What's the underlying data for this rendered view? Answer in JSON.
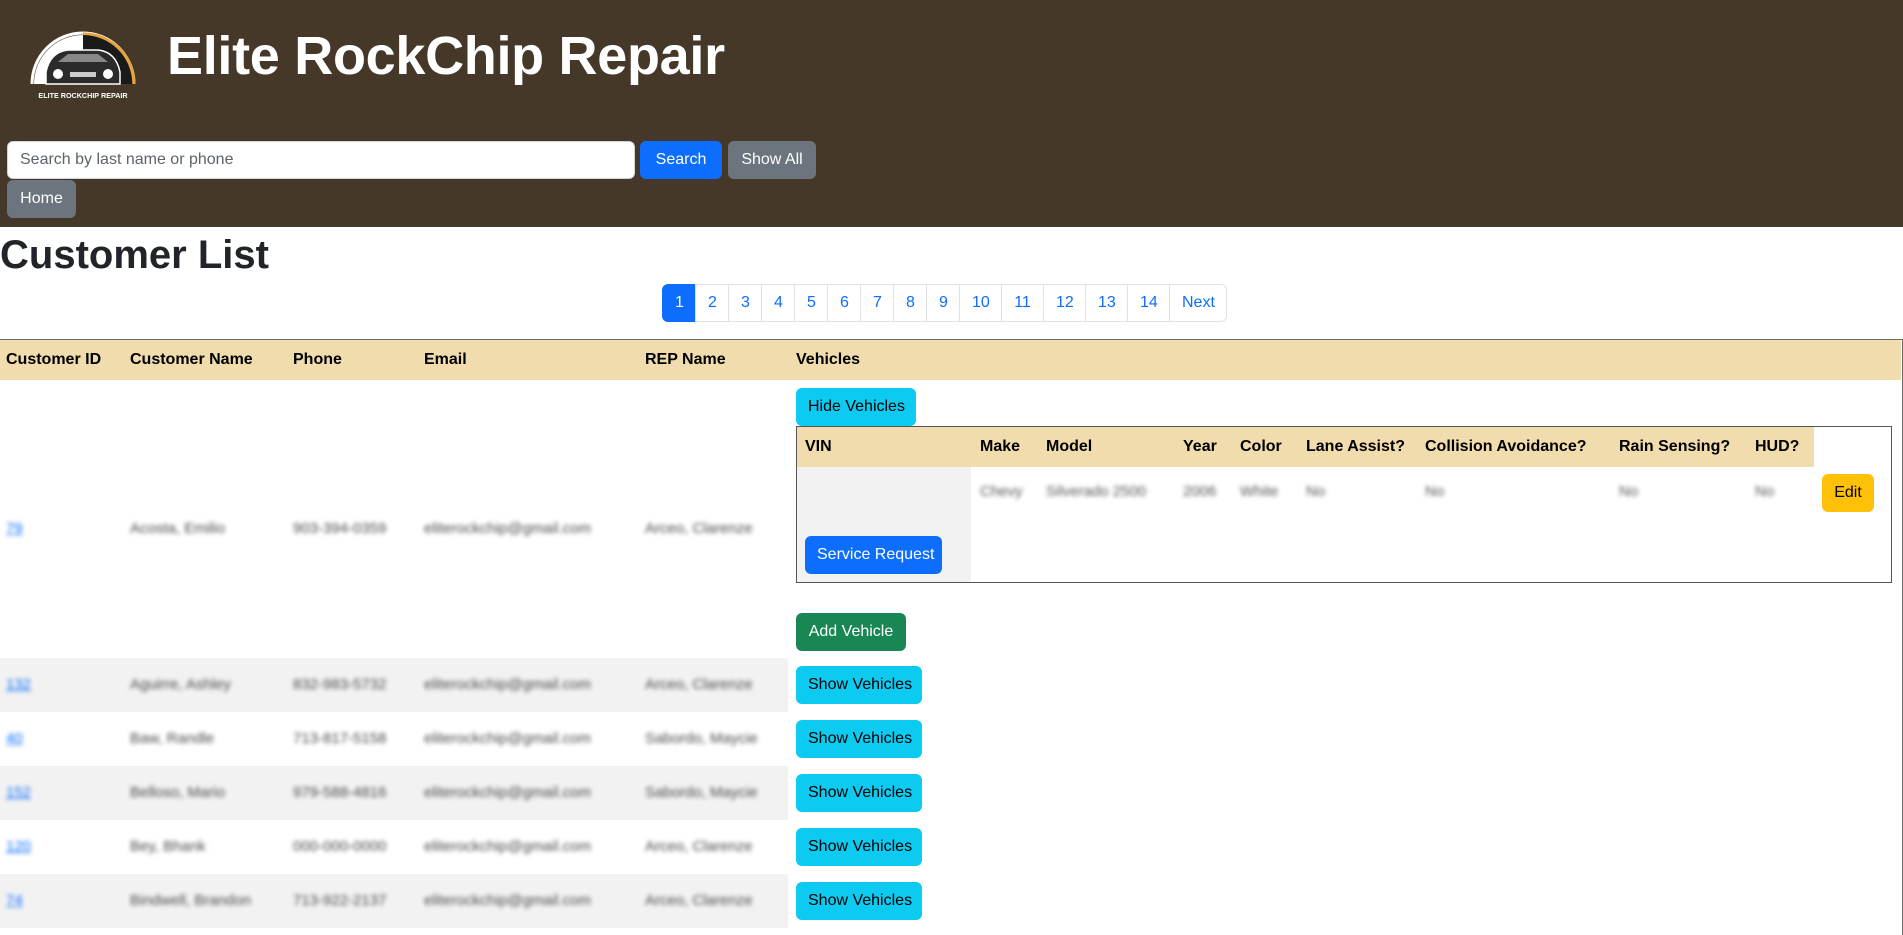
{
  "header": {
    "logo_text": "ELITE ROCKCHIP REPAIR",
    "title": "Elite RockChip Repair",
    "search_placeholder": "Search by last name or phone",
    "search_value": "",
    "search_label": "Search",
    "show_all_label": "Show All",
    "home_label": "Home",
    "background": "#453829"
  },
  "page": {
    "title": "Customer List"
  },
  "pagination": {
    "pages": [
      "1",
      "2",
      "3",
      "4",
      "5",
      "6",
      "7",
      "8",
      "9",
      "10",
      "11",
      "12",
      "13",
      "14"
    ],
    "active": "1",
    "next_label": "Next"
  },
  "table": {
    "headers": {
      "id": "Customer ID",
      "name": "Customer Name",
      "phone": "Phone",
      "email": "Email",
      "rep": "REP Name",
      "vehicles": "Vehicles"
    },
    "header_color": "#f0dcac",
    "rows": [
      {
        "id": "79",
        "name": "Acosta, Emilio",
        "phone": "903-394-0359",
        "email": "eliterockchip@gmail.com",
        "rep": "Arceo, Clarenze",
        "vehicles_button": "Hide Vehicles"
      },
      {
        "id": "132",
        "name": "Aguirre, Ashley",
        "phone": "832-983-5732",
        "email": "eliterockchip@gmail.com",
        "rep": "Arceo, Clarenze",
        "vehicles_button": "Show Vehicles"
      },
      {
        "id": "40",
        "name": "Baw, Randle",
        "phone": "713-817-5158",
        "email": "eliterockchip@gmail.com",
        "rep": "Sabordo, Maycie",
        "vehicles_button": "Show Vehicles"
      },
      {
        "id": "152",
        "name": "Bellosо, Mario",
        "phone": "979-588-4816",
        "email": "eliterockchip@gmail.com",
        "rep": "Sabordo, Maycie",
        "vehicles_button": "Show Vehicles"
      },
      {
        "id": "120",
        "name": "Bey, Bhank",
        "phone": "000-000-0000",
        "email": "eliterockchip@gmail.com",
        "rep": "Arceo, Clarenze",
        "vehicles_button": "Show Vehicles"
      },
      {
        "id": "74",
        "name": "Bindwell, Brandon",
        "phone": "713-922-2137",
        "email": "eliterockchip@gmail.com",
        "rep": "Arceo, Clarenze",
        "vehicles_button": "Show Vehicles"
      }
    ]
  },
  "vehicles": {
    "headers": {
      "vin": "VIN",
      "make": "Make",
      "model": "Model",
      "year": "Year",
      "color": "Color",
      "lane": "Lane Assist?",
      "collision": "Collision Avoidance?",
      "rain": "Rain Sensing?",
      "hud": "HUD?"
    },
    "rows": [
      {
        "vin": "",
        "make": "Chevy",
        "model": "Silverado 2500",
        "year": "2006",
        "color": "White",
        "lane": "No",
        "collision": "No",
        "rain": "No",
        "hud": "No"
      }
    ],
    "edit_label": "Edit",
    "service_request_label": "Service Request",
    "add_vehicle_label": "Add Vehicle"
  }
}
